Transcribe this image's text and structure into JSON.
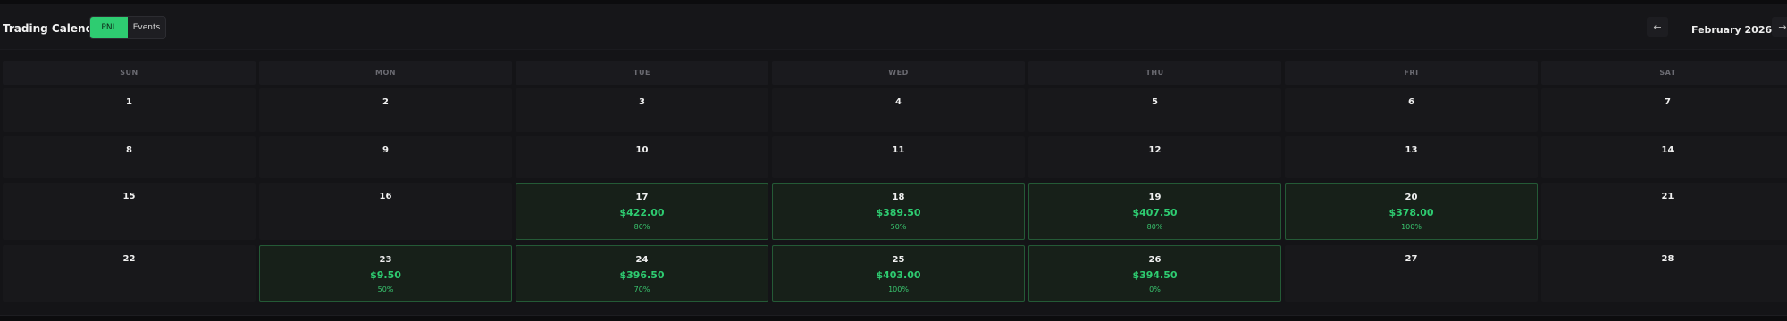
{
  "header": {
    "title": "Trading Calendar",
    "toggle": [
      {
        "label": "PNL",
        "active": true
      },
      {
        "label": "Events",
        "active": false
      }
    ],
    "prev_icon": "←",
    "next_icon": "→",
    "month": "February 2026"
  },
  "colors": {
    "accent": "#2ecc71",
    "profit_bg": "#172019",
    "profit_border": "#245a36"
  },
  "weekdays": [
    "SUN",
    "MON",
    "TUE",
    "WED",
    "THU",
    "FRI",
    "SAT"
  ],
  "weeks": [
    [
      {
        "day": "1"
      },
      {
        "day": "2"
      },
      {
        "day": "3"
      },
      {
        "day": "4"
      },
      {
        "day": "5"
      },
      {
        "day": "6"
      },
      {
        "day": "7"
      }
    ],
    [
      {
        "day": "8"
      },
      {
        "day": "9"
      },
      {
        "day": "10"
      },
      {
        "day": "11"
      },
      {
        "day": "12"
      },
      {
        "day": "13"
      },
      {
        "day": "14"
      }
    ],
    [
      {
        "day": "15"
      },
      {
        "day": "16"
      },
      {
        "day": "17",
        "pnl": "$422.00",
        "pct": "80%"
      },
      {
        "day": "18",
        "pnl": "$389.50",
        "pct": "50%"
      },
      {
        "day": "19",
        "pnl": "$407.50",
        "pct": "80%"
      },
      {
        "day": "20",
        "pnl": "$378.00",
        "pct": "100%"
      },
      {
        "day": "21"
      }
    ],
    [
      {
        "day": "22"
      },
      {
        "day": "23",
        "pnl": "$9.50",
        "pct": "50%"
      },
      {
        "day": "24",
        "pnl": "$396.50",
        "pct": "70%"
      },
      {
        "day": "25",
        "pnl": "$403.00",
        "pct": "100%"
      },
      {
        "day": "26",
        "pnl": "$394.50",
        "pct": "0%"
      },
      {
        "day": "27"
      },
      {
        "day": "28"
      }
    ]
  ]
}
